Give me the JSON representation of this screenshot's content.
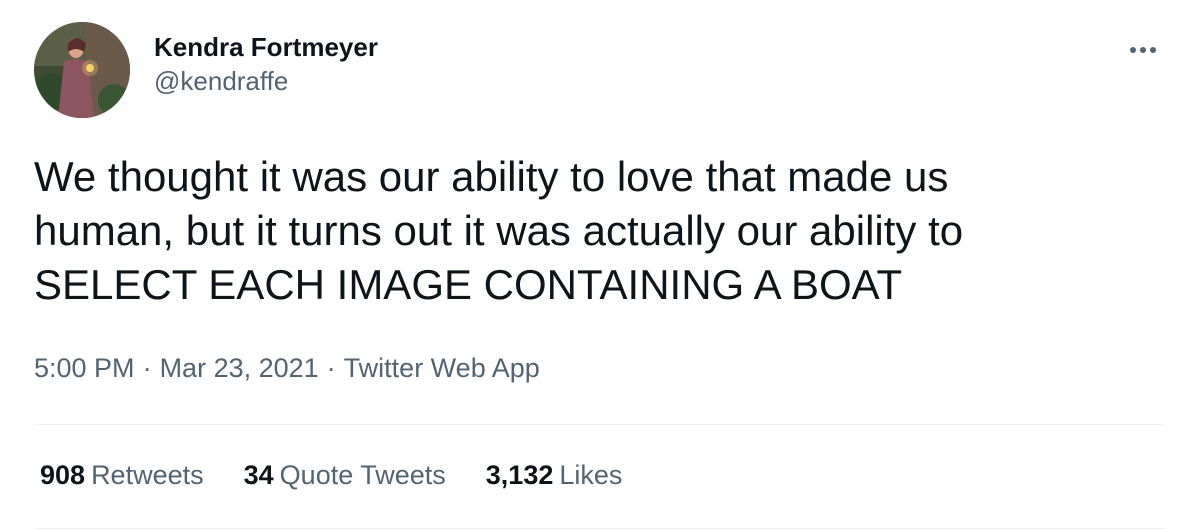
{
  "author": {
    "display_name": "Kendra Fortmeyer",
    "handle": "@kendraffe"
  },
  "tweet": {
    "lines": [
      "We thought it was our ability to love that made us",
      "human, but it turns out it was actually our ability to",
      "SELECT EACH IMAGE CONTAINING A BOAT"
    ]
  },
  "meta": {
    "time": "5:00 PM",
    "separator": "·",
    "date": "Mar 23, 2021",
    "source": "Twitter Web App"
  },
  "stats": {
    "retweets": {
      "count": "908",
      "label": "Retweets"
    },
    "quote_tweets": {
      "count": "34",
      "label": "Quote Tweets"
    },
    "likes": {
      "count": "3,132",
      "label": "Likes"
    }
  },
  "icons": {
    "more": "more-horizontal-icon"
  },
  "colors": {
    "text_primary": "#0f1419",
    "text_secondary": "#536471",
    "divider": "#eff3f4",
    "background": "#ffffff"
  }
}
